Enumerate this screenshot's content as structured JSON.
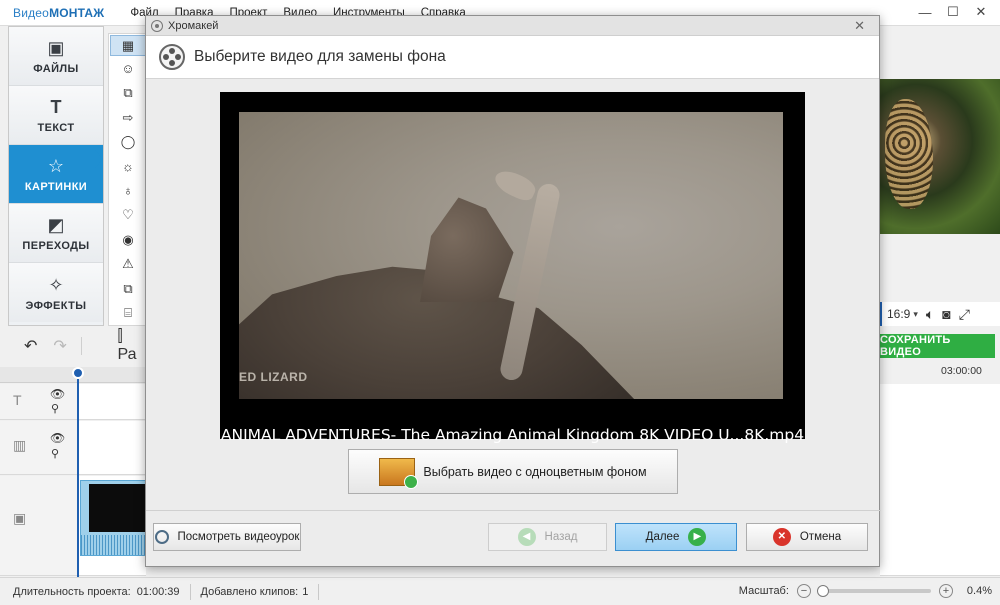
{
  "app": {
    "logo_light": "Видео",
    "logo_bold": "МОНТАЖ",
    "menu": [
      "Файл",
      "Правка",
      "Проект",
      "Видео",
      "Инструменты",
      "Справка"
    ],
    "window_controls": [
      "—",
      "☐",
      "✕"
    ]
  },
  "tools": [
    {
      "label": "ФАЙЛЫ",
      "icon": "image-icon",
      "glyph": "▣"
    },
    {
      "label": "ТЕКСТ",
      "icon": "text-icon",
      "glyph": "T"
    },
    {
      "label": "КАРТИНКИ",
      "icon": "star-icon",
      "glyph": "☆",
      "active": true
    },
    {
      "label": "ПЕРЕХОДЫ",
      "icon": "transitions-icon",
      "glyph": "◩"
    },
    {
      "label": "ЭФФЕКТЫ",
      "icon": "magic-wand-icon",
      "glyph": "✧"
    }
  ],
  "sticker_icons": [
    "▦",
    "☺",
    "⧉",
    "⇨",
    "◯",
    "☼",
    "♁",
    "♡",
    "◉",
    "⚠",
    "⧉",
    "⌸"
  ],
  "preview": {
    "aspect_ratio": "16:9",
    "save_label": "СОХРАНИТЬ ВИДЕО",
    "timecode": "03:00:00"
  },
  "timeline": {
    "split_label": "Ра"
  },
  "dialog": {
    "window_title": "Хромакей",
    "heading": "Выберите видео для замены фона",
    "video_watermark": "ED LIZARD",
    "video_filename": "ANIMAL ADVENTURES- The Amazing Animal Kingdom 8K VIDEO U...8K.mp4",
    "pick_video_label": "Выбрать видео с одноцветным фоном",
    "tutorial_label": "Посмотреть видеоурок",
    "back_label": "Назад",
    "next_label": "Далее",
    "cancel_label": "Отмена"
  },
  "status": {
    "duration_label": "Длительность проекта:",
    "duration_value": "01:00:39",
    "clips_label": "Добавлено клипов:",
    "clips_value": "1",
    "zoom_label": "Масштаб:",
    "zoom_value": "0.4%",
    "zoom_fraction": 0.04
  },
  "colors": {
    "accent": "#1f8fd1",
    "save_green": "#2fae43",
    "next_blue": "#9bd0f3",
    "cancel_red": "#d9342b"
  }
}
